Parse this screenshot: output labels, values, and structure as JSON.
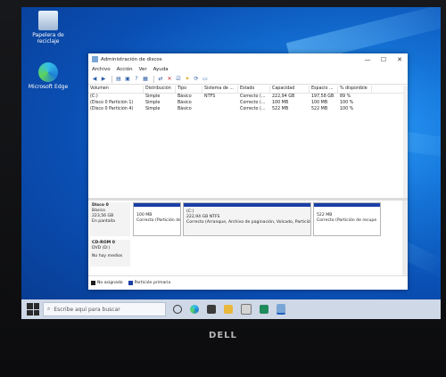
{
  "desktop": {
    "icons": [
      {
        "label": "Papelera de reciclaje",
        "icon": "recycle-bin-icon"
      },
      {
        "label": "Microsoft Edge",
        "icon": "edge-icon"
      }
    ]
  },
  "window": {
    "title": "Administración de discos",
    "controls": {
      "minimize": "—",
      "maximize": "☐",
      "close": "✕"
    },
    "menu": [
      "Archivo",
      "Acción",
      "Ver",
      "Ayuda"
    ],
    "volume_table": {
      "columns": [
        "Volumen",
        "Distribución",
        "Tipo",
        "Sistema de ...",
        "Estado",
        "Capacidad",
        "Espacio ...",
        "% disponible"
      ],
      "rows": [
        [
          "(C:)",
          "Simple",
          "Básico",
          "NTFS",
          "Correcto (...",
          "222,94 GB",
          "197,58 GB",
          "89 %"
        ],
        [
          "(Disco 0 Partición 1)",
          "Simple",
          "Básico",
          "",
          "Correcto (...",
          "100 MB",
          "100 MB",
          "100 %"
        ],
        [
          "(Disco 0 Partición 4)",
          "Simple",
          "Básico",
          "",
          "Correcto (...",
          "522 MB",
          "522 MB",
          "100 %"
        ]
      ]
    },
    "disk_map": {
      "disk0": {
        "name": "Disco 0",
        "type": "Básico",
        "size": "223,56 GB",
        "status": "En pantalla",
        "partitions": [
          {
            "size": "100 MB",
            "status": "Correcto (Partición de"
          },
          {
            "name": "(C:)",
            "size": "222,94 GB NTFS",
            "status": "Correcto (Arranque, Archivo de paginación, Volcado, Partición"
          },
          {
            "size": "522 MB",
            "status": "Correcto (Partición de recupe"
          }
        ]
      },
      "cdrom0": {
        "name": "CD-ROM 0",
        "type": "DVD (D:)",
        "status": "No hay medios"
      }
    },
    "legend": [
      {
        "label": "No asignado",
        "color": "#1c1c1c"
      },
      {
        "label": "Partición primaria",
        "color": "#1b3fa6"
      }
    ]
  },
  "taskbar": {
    "search_placeholder": "Escribe aquí para buscar",
    "apps": [
      "task-view-icon",
      "edge-icon",
      "file-explorer-icon",
      "folder-icon",
      "mail-icon",
      "store-icon",
      "disk-management-icon"
    ]
  },
  "bezel": {
    "brand": "DELL"
  }
}
